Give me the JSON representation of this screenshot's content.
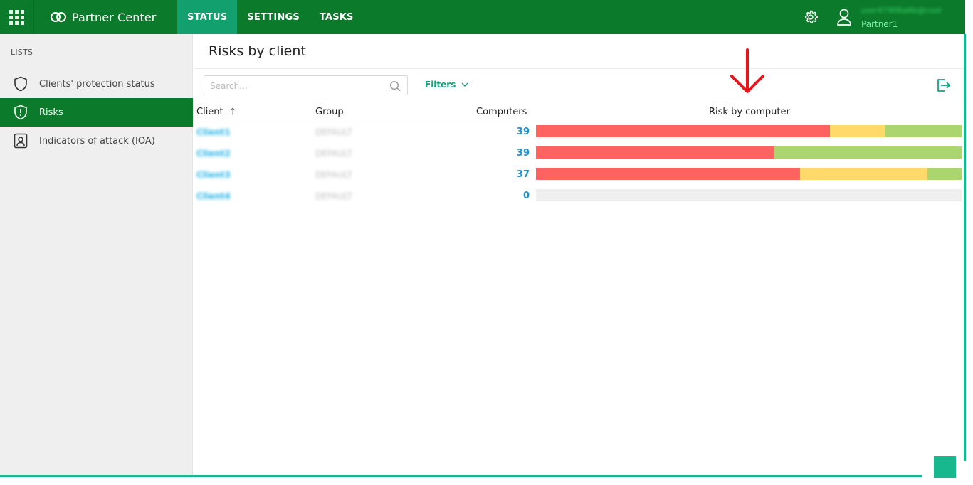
{
  "header": {
    "app_name": "Partner Center",
    "apps_icon": "apps-grid-icon",
    "nav_tabs": [
      {
        "label": "STATUS",
        "active": true
      },
      {
        "label": "SETTINGS",
        "active": false
      },
      {
        "label": "TASKS",
        "active": false
      }
    ],
    "settings_icon": "gear-icon",
    "user": {
      "email": "user47406a6b@cool",
      "name": "Partner1",
      "icon": "user-icon"
    }
  },
  "sidebar": {
    "header": "LISTS",
    "items": [
      {
        "label": "Clients' protection status",
        "icon": "shield-icon",
        "active": false
      },
      {
        "label": "Risks",
        "icon": "shield-alert-icon",
        "active": true
      },
      {
        "label": "Indicators of attack (IOA)",
        "icon": "id-badge-icon",
        "active": false
      }
    ]
  },
  "main": {
    "title": "Risks by client",
    "search": {
      "placeholder": "Search...",
      "value": ""
    },
    "filters_label": "Filters",
    "export_icon": "export-icon",
    "table": {
      "columns": {
        "client": "Client",
        "group": "Group",
        "computers": "Computers",
        "risk": "Risk by computer"
      },
      "sort": {
        "column": "client",
        "direction": "ascending"
      },
      "rows": [
        {
          "client": "Client1",
          "group": "DEFAULT",
          "computers": "39",
          "risk": {
            "high": 0.69,
            "medium": 0.13,
            "low": 0.18
          }
        },
        {
          "client": "Client2",
          "group": "DEFAULT",
          "computers": "39",
          "risk": {
            "high": 0.56,
            "medium": 0.0,
            "low": 0.44
          }
        },
        {
          "client": "Client3",
          "group": "DEFAULT",
          "computers": "37",
          "risk": {
            "high": 0.62,
            "medium": 0.3,
            "low": 0.08
          }
        },
        {
          "client": "Client4",
          "group": "DEFAULT",
          "computers": "0",
          "risk": {
            "high": 0,
            "medium": 0,
            "low": 0
          }
        }
      ]
    }
  },
  "colors": {
    "topbar": "#0b7a2a",
    "active_tab": "#12a06e",
    "accent_teal": "#13a57f",
    "risk_high": "#ff6361",
    "risk_medium": "#ffd96a",
    "risk_low": "#abd56e",
    "risk_empty": "#efefef",
    "link_blue": "#1a94d4",
    "annotation_arrow": "#e8141b"
  }
}
